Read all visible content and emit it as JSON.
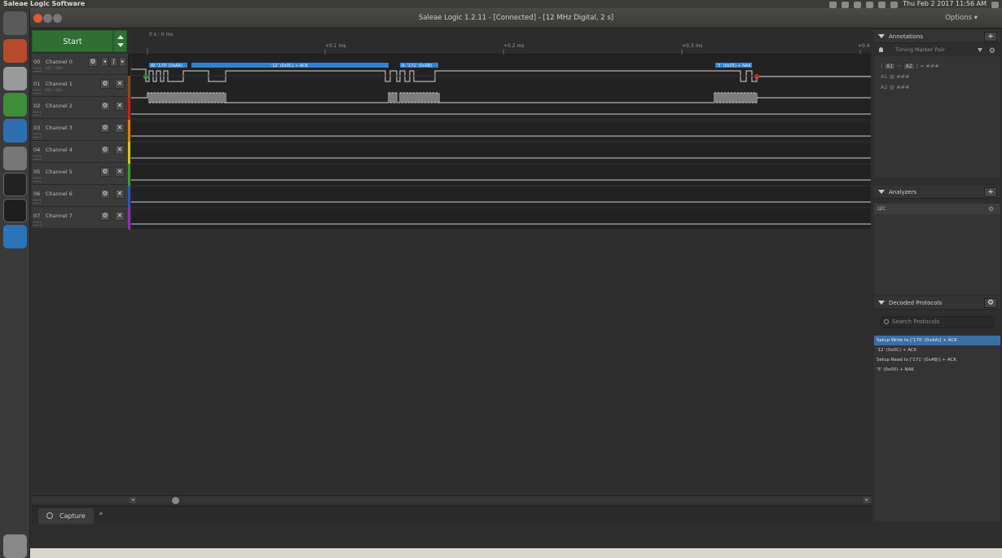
{
  "topbar": {
    "app_name": "Saleae Logic Software",
    "clock": "Thu Feb 2 2017 11:56 AM"
  },
  "window": {
    "title": "Saleae Logic 1.2.11 - [Connected] - [12 MHz Digital, 2 s]",
    "options_label": "Options ▾"
  },
  "capture": {
    "start_label": "Start"
  },
  "channels": [
    {
      "num": "00",
      "name": "Channel 0",
      "sub": "I2C - SDA",
      "color": "#1f1f1f"
    },
    {
      "num": "01",
      "name": "Channel 1",
      "sub": "I2C - SCL",
      "color": "#8b4a21"
    },
    {
      "num": "02",
      "name": "Channel 2",
      "sub": "",
      "color": "#c0241b"
    },
    {
      "num": "03",
      "name": "Channel 3",
      "sub": "",
      "color": "#e07c10"
    },
    {
      "num": "04",
      "name": "Channel 4",
      "sub": "",
      "color": "#d9c617"
    },
    {
      "num": "05",
      "name": "Channel 5",
      "sub": "",
      "color": "#3b9c2b"
    },
    {
      "num": "06",
      "name": "Channel 6",
      "sub": "",
      "color": "#2e57b8"
    },
    {
      "num": "07",
      "name": "Channel 7",
      "sub": "",
      "color": "#8e2fb3"
    }
  ],
  "ruler": {
    "origin": "0 s : 0 ms",
    "ticks": [
      "+0.1 ms",
      "+0.2 ms",
      "+0.3 ms",
      "+0.4"
    ]
  },
  "decodes": [
    {
      "label": "W: '170' (0xAA)"
    },
    {
      "label": "'12' (0x0C) + ACK"
    },
    {
      "label": "R: '171' (0xAB)"
    },
    {
      "label": "'5' (0x05) + NAK"
    }
  ],
  "bottom": {
    "capture_tab": "Capture",
    "expand_icon": "»"
  },
  "annotations": {
    "title": "Annotations",
    "timing_pair": "Timing Marker Pair",
    "line1_a": "A1",
    "line1_b": "A2",
    "line1_eq": "= ###",
    "line2": "A1  @  ###",
    "line3": "A2  @  ###"
  },
  "analyzers": {
    "title": "Analyzers",
    "items": [
      "I2C"
    ]
  },
  "decoded_protocols": {
    "title": "Decoded Protocols",
    "search_placeholder": "Search Protocols",
    "items": [
      "Setup Write to ['170' (0xAA)] + ACK",
      "'12' (0x0C) + ACK",
      "Setup Read to ['171' (0xAB)] + ACK",
      "'5' (0x05) + NAK"
    ]
  },
  "colors": {
    "start_green": "#2f6f34",
    "decode_blue": "#2e83d0",
    "selected_blue": "#3b6fa3"
  }
}
